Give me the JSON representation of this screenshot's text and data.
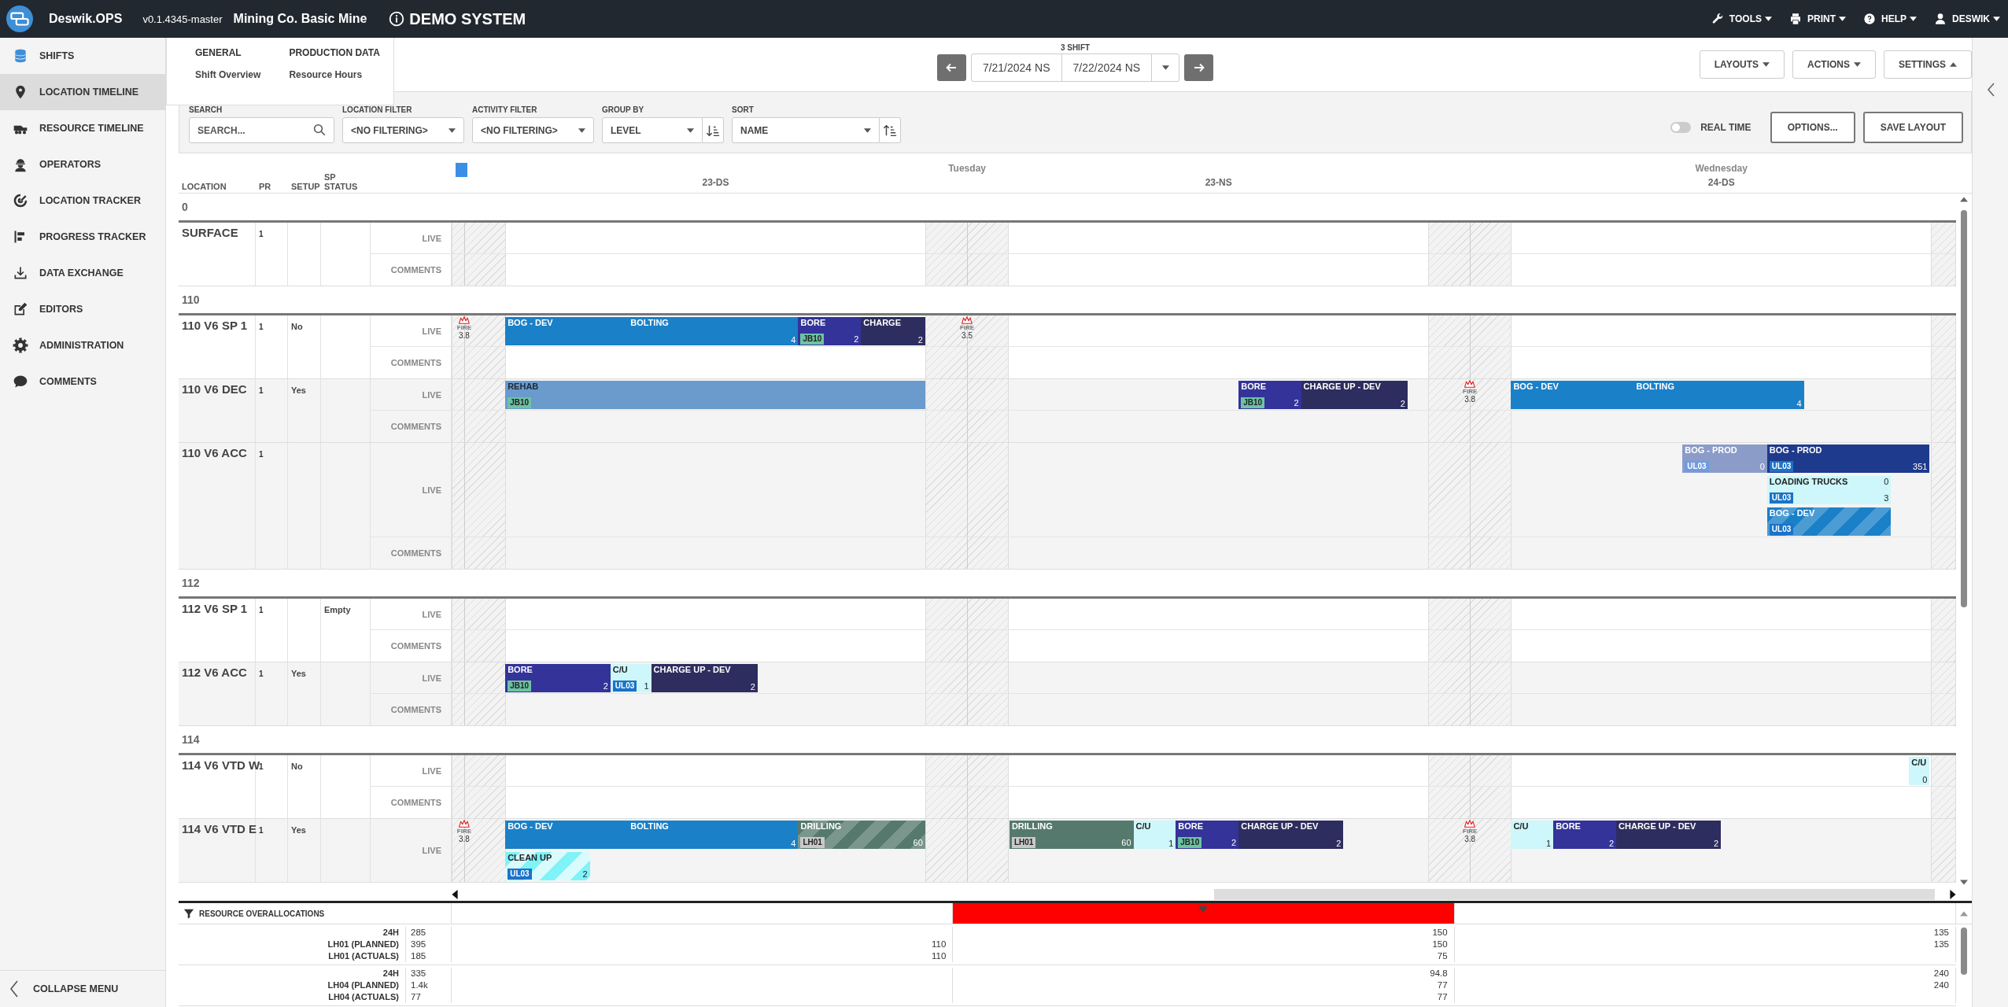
{
  "header": {
    "brand": "Deswik.OPS",
    "version": "v0.1.4345-master",
    "site": "Mining Co. Basic Mine",
    "banner": "DEMO SYSTEM",
    "menus": [
      {
        "label": "TOOLS"
      },
      {
        "label": "PRINT"
      },
      {
        "label": "HELP"
      },
      {
        "label": "DESWIK"
      }
    ]
  },
  "sidebar": {
    "items": [
      {
        "label": "SHIFTS",
        "selected": false
      },
      {
        "label": "LOCATION TIMELINE",
        "selected": true
      },
      {
        "label": "RESOURCE TIMELINE",
        "selected": false
      },
      {
        "label": "OPERATORS",
        "selected": false
      },
      {
        "label": "LOCATION TRACKER",
        "selected": false
      },
      {
        "label": "PROGRESS TRACKER",
        "selected": false
      },
      {
        "label": "DATA EXCHANGE",
        "selected": false
      },
      {
        "label": "EDITORS",
        "selected": false
      },
      {
        "label": "ADMINISTRATION",
        "selected": false
      },
      {
        "label": "COMMENTS",
        "selected": false
      }
    ],
    "collapse": "COLLAPSE MENU"
  },
  "menu": {
    "columns": [
      {
        "heading": "GENERAL",
        "links": [
          "Shift Overview"
        ]
      },
      {
        "heading": "PRODUCTION DATA",
        "links": [
          "Resource Hours"
        ]
      }
    ]
  },
  "toolbar": {
    "shift_label": "3 SHIFT",
    "from": "7/21/2024 NS",
    "to": "7/22/2024 NS",
    "buttons": [
      {
        "label": "LAYOUTS",
        "open": false
      },
      {
        "label": "ACTIONS",
        "open": false
      },
      {
        "label": "SETTINGS",
        "open": true
      }
    ]
  },
  "filters": {
    "search": {
      "label": "SEARCH",
      "placeholder": "SEARCH..."
    },
    "selects": [
      {
        "label": "LOCATION FILTER",
        "value": "<NO FILTERING>"
      },
      {
        "label": "ACTIVITY FILTER",
        "value": "<NO FILTERING>"
      },
      {
        "label": "GROUP BY",
        "value": "LEVEL",
        "ascending": false
      },
      {
        "label": "SORT",
        "value": "NAME",
        "ascending": true
      }
    ],
    "real_time": {
      "label": "REAL TIME",
      "on": false
    },
    "buttons": [
      "OPTIONS...",
      "SAVE LAYOUT"
    ]
  },
  "timeline": {
    "columns": [
      "LOCATION",
      "PR",
      "SETUP",
      "SP STATUS"
    ],
    "days": [
      "Tuesday",
      "Wednesday"
    ],
    "shifts": [
      "23-DS",
      "23-NS",
      "24-DS"
    ],
    "groups": [
      {
        "label": "0",
        "rows": [
          {
            "name": "SURFACE",
            "pr": "1",
            "tracks": [
              {
                "label": "LIVE"
              },
              {
                "label": "COMMENTS"
              }
            ]
          }
        ]
      },
      {
        "label": "110",
        "rows": [
          {
            "name": "110 V6 SP 1",
            "pr": "1",
            "setup": "No",
            "tracks": [
              {
                "label": "LIVE",
                "markers": [
                  {
                    "label": "FIRE",
                    "value": "3.8"
                  },
                  {
                    "label": "FIRE",
                    "value": "3.5"
                  }
                ],
                "lanes": [
                  {
                    "items": [
                      {
                        "kind": "bog-dev",
                        "title": "BOG - DEV",
                        "striped": false
                      },
                      {
                        "kind": "bog-dev",
                        "title": "BOLTING",
                        "count": "4",
                        "striped": false
                      },
                      {
                        "kind": "bore",
                        "title": "BORE",
                        "tag": {
                          "text": "JB10",
                          "color": "#6cc3a4"
                        },
                        "count": "2",
                        "striped": false
                      },
                      {
                        "kind": "charge",
                        "title": "CHARGE",
                        "count": "2",
                        "striped": false
                      }
                    ]
                  }
                ]
              },
              {
                "label": "COMMENTS"
              }
            ]
          },
          {
            "name": "110 V6 DEC",
            "pr": "1",
            "setup": "Yes",
            "tracks": [
              {
                "label": "LIVE",
                "markers": [
                  {
                    "label": "FIRE",
                    "value": "3.8"
                  }
                ],
                "lanes": [
                  {
                    "items": [
                      {
                        "kind": "rehab",
                        "title": "REHAB",
                        "tag": {
                          "text": "JB10",
                          "color": "#6cc3a4"
                        },
                        "striped": false
                      },
                      {
                        "kind": "bore",
                        "title": "BORE",
                        "tag": {
                          "text": "JB10",
                          "color": "#6cc3a4"
                        },
                        "count": "2",
                        "striped": false
                      },
                      {
                        "kind": "charge",
                        "title": "CHARGE UP - DEV",
                        "count": "2",
                        "striped": false
                      },
                      {
                        "kind": "bog-dev",
                        "title": "BOG - DEV",
                        "striped": false
                      },
                      {
                        "kind": "bog-dev",
                        "title": "BOLTING",
                        "count": "4",
                        "striped": false
                      }
                    ]
                  }
                ]
              },
              {
                "label": "COMMENTS"
              }
            ]
          },
          {
            "name": "110 V6 ACC",
            "pr": "1",
            "tracks": [
              {
                "label": "LIVE",
                "lanes": [
                  {
                    "items": [
                      {
                        "kind": "planned",
                        "title": "BOG - PROD",
                        "tag": {
                          "text": "UL03",
                          "color": "#6f9be0"
                        },
                        "count": "0",
                        "striped": false
                      },
                      {
                        "kind": "bog-prod",
                        "title": "BOG - PROD",
                        "tag": {
                          "text": "UL03",
                          "color": "#1a73c9"
                        },
                        "count": "351",
                        "striped": false
                      }
                    ]
                  },
                  {
                    "items": [
                      {
                        "kind": "light",
                        "title": "LOADING TRUCKS",
                        "top_count": "0",
                        "tag": {
                          "text": "UL03",
                          "color": "#1a73c9"
                        },
                        "count": "3",
                        "striped": false
                      }
                    ]
                  },
                  {
                    "items": [
                      {
                        "kind": "bog-dev",
                        "title": "BOG - DEV",
                        "tag": {
                          "text": "UL03",
                          "color": "#1a73c9"
                        },
                        "striped": true
                      }
                    ]
                  }
                ]
              },
              {
                "label": "COMMENTS"
              }
            ]
          }
        ]
      },
      {
        "label": "112",
        "rows": [
          {
            "name": "112 V6 SP 1",
            "pr": "1",
            "sp_status": "Empty",
            "tracks": [
              {
                "label": "LIVE"
              },
              {
                "label": "COMMENTS"
              }
            ]
          },
          {
            "name": "112 V6 ACC",
            "pr": "1",
            "setup": "Yes",
            "tracks": [
              {
                "label": "LIVE",
                "lanes": [
                  {
                    "items": [
                      {
                        "kind": "bore",
                        "title": "BORE",
                        "tag": {
                          "text": "JB10",
                          "color": "#6cc3a4"
                        },
                        "count": "2",
                        "striped": false
                      },
                      {
                        "kind": "light",
                        "title": "C/U",
                        "tag": {
                          "text": "UL03",
                          "color": "#1a73c9"
                        },
                        "count": "1",
                        "striped": false
                      },
                      {
                        "kind": "charge",
                        "title": "CHARGE UP - DEV",
                        "count": "2",
                        "striped": false
                      }
                    ]
                  }
                ]
              },
              {
                "label": "COMMENTS"
              }
            ]
          }
        ]
      },
      {
        "label": "114",
        "rows": [
          {
            "name": "114 V6 VTD W",
            "pr": "1",
            "setup": "No",
            "tracks": [
              {
                "label": "LIVE",
                "lanes": [
                  {
                    "items": [
                      {
                        "kind": "light",
                        "title": "C/U",
                        "count": "0",
                        "striped": false
                      }
                    ]
                  }
                ]
              },
              {
                "label": "COMMENTS"
              }
            ]
          },
          {
            "name": "114 V6 VTD E",
            "pr": "1",
            "setup": "Yes",
            "tracks": [
              {
                "label": "LIVE",
                "markers": [
                  {
                    "label": "FIRE",
                    "value": "3.8"
                  },
                  {
                    "label": "FIRE",
                    "value": "3.8"
                  }
                ],
                "lanes": [
                  {
                    "items": [
                      {
                        "kind": "bog-dev",
                        "title": "BOG - DEV",
                        "striped": false
                      },
                      {
                        "kind": "bog-dev",
                        "title": "BOLTING",
                        "count": "4",
                        "striped": false
                      },
                      {
                        "kind": "drilling",
                        "title": "DRILLING",
                        "tag": {
                          "text": "LH01",
                          "color": "#c9c9c9"
                        },
                        "count": "60",
                        "striped": true
                      },
                      {
                        "kind": "drilling",
                        "title": "DRILLING",
                        "tag": {
                          "text": "LH01",
                          "color": "#c9c9c9"
                        },
                        "count": "60",
                        "striped": false
                      },
                      {
                        "kind": "light",
                        "title": "C/U",
                        "count": "1",
                        "striped": false
                      },
                      {
                        "kind": "bore",
                        "title": "BORE",
                        "tag": {
                          "text": "JB10",
                          "color": "#6cc3a4"
                        },
                        "count": "2",
                        "striped": false
                      },
                      {
                        "kind": "charge",
                        "title": "CHARGE UP - DEV",
                        "count": "2",
                        "striped": false
                      },
                      {
                        "kind": "light",
                        "title": "C/U",
                        "count": "1",
                        "striped": false
                      },
                      {
                        "kind": "bore",
                        "title": "BORE",
                        "count": "2",
                        "striped": false
                      },
                      {
                        "kind": "charge",
                        "title": "CHARGE UP - DEV",
                        "count": "2",
                        "striped": false
                      }
                    ]
                  },
                  {
                    "items": [
                      {
                        "kind": "cyan",
                        "title": "CLEAN UP",
                        "tag": {
                          "text": "UL03",
                          "color": "#1a73c9"
                        },
                        "count": "2",
                        "striped": true
                      }
                    ]
                  }
                ]
              }
            ]
          }
        ]
      }
    ]
  },
  "overallocations": {
    "title": "RESOURCE OVERALLOCATIONS",
    "shifts": [
      {
        "overallocated": false
      },
      {
        "overallocated": true
      },
      {
        "overallocated": false
      }
    ],
    "groups": [
      {
        "lines": [
          {
            "label": "24H",
            "total": "285",
            "shift_2": "150",
            "shift_3": "135"
          },
          {
            "label": "LH01 (PLANNED)",
            "total": "395",
            "shift_1": "110",
            "shift_2": "150",
            "shift_3": "135"
          },
          {
            "label": "LH01 (ACTUALS)",
            "total": "185",
            "shift_1": "110",
            "shift_2": "75"
          }
        ]
      },
      {
        "lines": [
          {
            "label": "24H",
            "total": "335",
            "shift_2": "94.8",
            "shift_3": "240"
          },
          {
            "label": "LH04 (PLANNED)",
            "total": "1.4k",
            "shift_2": "77",
            "shift_3": "240"
          },
          {
            "label": "LH04 (ACTUALS)",
            "total": "77",
            "shift_2": "77"
          }
        ]
      }
    ]
  }
}
